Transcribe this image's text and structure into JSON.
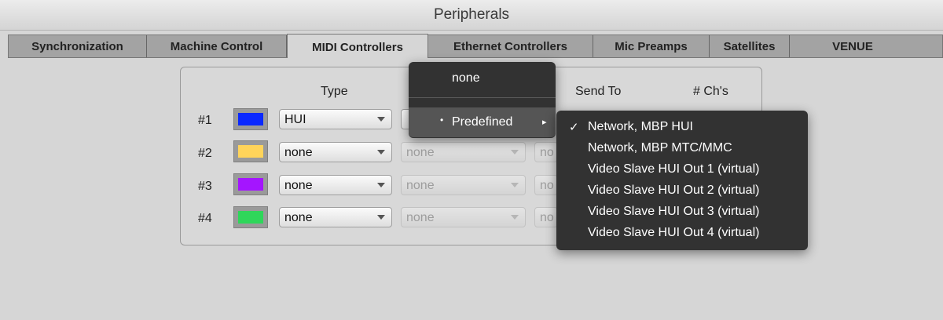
{
  "window": {
    "title": "Peripherals"
  },
  "tabs": [
    {
      "label": "Synchronization",
      "active": false
    },
    {
      "label": "Machine Control",
      "active": false
    },
    {
      "label": "MIDI Controllers",
      "active": true
    },
    {
      "label": "Ethernet Controllers",
      "active": false
    },
    {
      "label": "Mic Preamps",
      "active": false
    },
    {
      "label": "Satellites",
      "active": false
    },
    {
      "label": "VENUE",
      "active": false
    }
  ],
  "columns": {
    "type": "Type",
    "send_to": "Send To",
    "channels": "# Ch's"
  },
  "rows": [
    {
      "label": "#1",
      "color": "#0a28ff",
      "type": "HUI",
      "receive": "",
      "send": ""
    },
    {
      "label": "#2",
      "color": "#ffd45a",
      "type": "none",
      "receive": "none",
      "send": "no"
    },
    {
      "label": "#3",
      "color": "#a415ff",
      "type": "none",
      "receive": "none",
      "send": "no"
    },
    {
      "label": "#4",
      "color": "#2fd65a",
      "type": "none",
      "receive": "none",
      "send": "no"
    }
  ],
  "popup_menu": {
    "none_label": "none",
    "predefined_label": "Predefined",
    "submenu_arrow": "▸",
    "bullet": "•"
  },
  "submenu": {
    "checkmark": "✓",
    "items": [
      "Network, MBP HUI",
      "Network, MBP MTC/MMC",
      "Video Slave HUI Out 1 (virtual)",
      "Video Slave HUI Out 2 (virtual)",
      "Video Slave HUI Out 3 (virtual)",
      "Video Slave HUI Out 4 (virtual)"
    ],
    "checked_index": 0
  }
}
